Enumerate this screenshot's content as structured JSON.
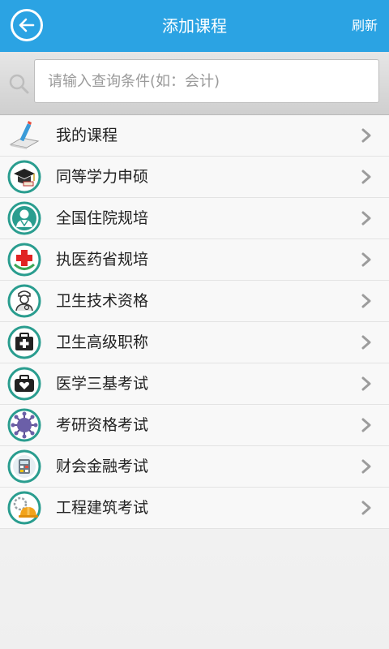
{
  "header": {
    "title": "添加课程",
    "refresh_label": "刷新",
    "back_icon": "back-arrow-icon",
    "background": "#2ba3e3"
  },
  "search": {
    "placeholder": "请输入查询条件(如：会计)",
    "value": ""
  },
  "items": [
    {
      "label": "我的课程",
      "icon": "pencil-pad-icon"
    },
    {
      "label": "同等学力申硕",
      "icon": "graduation-cap-icon"
    },
    {
      "label": "全国住院规培",
      "icon": "doctor-icon"
    },
    {
      "label": "执医药省规培",
      "icon": "red-cross-icon"
    },
    {
      "label": "卫生技术资格",
      "icon": "nurse-icon"
    },
    {
      "label": "卫生高级职称",
      "icon": "medical-kit-icon"
    },
    {
      "label": "医学三基考试",
      "icon": "heart-bag-icon"
    },
    {
      "label": "考研资格考试",
      "icon": "virus-icon"
    },
    {
      "label": "财会金融考试",
      "icon": "calculator-icon"
    },
    {
      "label": "工程建筑考试",
      "icon": "hard-hat-icon"
    }
  ]
}
